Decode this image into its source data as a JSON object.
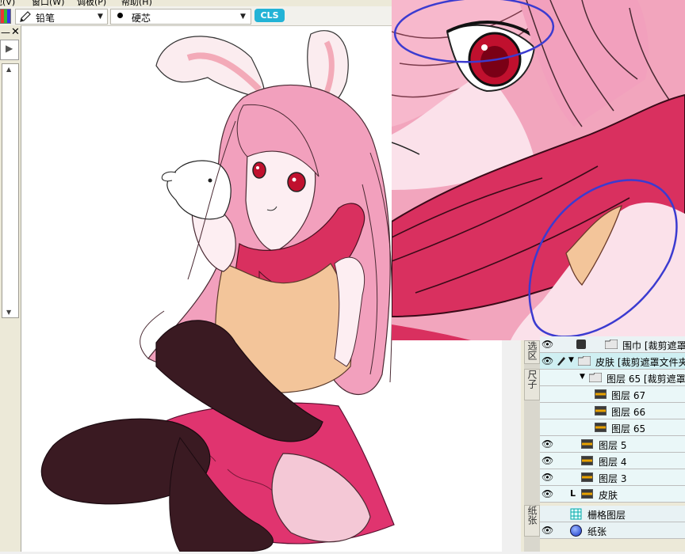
{
  "menubar": {
    "items": [
      "视(V)",
      "窗口(W)",
      "调板(P)",
      "帮助(H)"
    ]
  },
  "toolbar": {
    "tool_name": "铅笔",
    "brush_tip": "硬芯",
    "logo_text": "CLS"
  },
  "side_tabs": {
    "select": "选区",
    "ruler": "尺子",
    "paper": "纸张"
  },
  "layers": [
    {
      "name": "围巾 [裁剪遮罩",
      "type": "folder",
      "visible": true
    },
    {
      "name": "皮肤 [裁剪遮罩文件夹",
      "type": "folder",
      "visible": true,
      "selected": true
    },
    {
      "name": "图层 65 [裁剪遮罩",
      "type": "folder",
      "visible": false
    },
    {
      "name": "图层 67",
      "type": "layer",
      "visible": false
    },
    {
      "name": "图层 66",
      "type": "layer",
      "visible": false
    },
    {
      "name": "图层 65",
      "type": "layer",
      "visible": false
    },
    {
      "name": "图层 5",
      "type": "layer",
      "visible": true
    },
    {
      "name": "图层 4",
      "type": "layer",
      "visible": true
    },
    {
      "name": "图层 3",
      "type": "layer",
      "visible": true
    },
    {
      "name": "皮肤",
      "type": "layer",
      "visible": true
    }
  ],
  "base_layers": [
    {
      "name": "栅格图层",
      "icon": "grid-icon"
    },
    {
      "name": "纸张",
      "icon": "paper-icon"
    }
  ],
  "colors": {
    "hair": "#f2a0bd",
    "scarf": "#d9305f",
    "stockings": "#3a1a22",
    "skirt": "#e0346f",
    "shirt": "#f3c59a",
    "eyes": "#c0102e",
    "selected_row": "#cfeff2",
    "annotation": "#3b3bd0"
  }
}
